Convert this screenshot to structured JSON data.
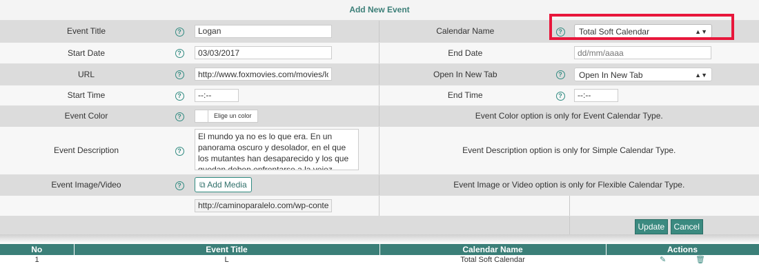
{
  "form": {
    "title": "Add New Event",
    "event_title": {
      "label": "Event Title",
      "value": "Logan"
    },
    "calendar_name": {
      "label": "Calendar Name",
      "value": "Total Soft Calendar"
    },
    "start_date": {
      "label": "Start Date",
      "value": "03/03/2017"
    },
    "end_date": {
      "label": "End Date",
      "placeholder": "dd/mm/aaaa"
    },
    "url": {
      "label": "URL",
      "value": "http://www.foxmovies.com/movies/log"
    },
    "open_in_new_tab": {
      "label": "Open In New Tab",
      "value": "Open In New Tab"
    },
    "start_time": {
      "label": "Start Time",
      "value": "--:--"
    },
    "end_time": {
      "label": "End Time",
      "value": "--:--"
    },
    "event_color": {
      "label": "Event Color",
      "button": "Elige un color",
      "note": "Event Color option is only for Event Calendar Type."
    },
    "event_description": {
      "label": "Event Description",
      "value": "El mundo ya no es lo que era. En un panorama oscuro y desolador, en el que los mutantes han desaparecido y los que quedan deben enfrentarse a la vejez, Logan, también",
      "note": "Event Description option is only for Simple Calendar Type."
    },
    "event_media": {
      "label": "Event Image/Video",
      "button": "Add Media",
      "note": "Event Image or Video option is only for Flexible Calendar Type.",
      "path": "http://caminoparalelo.com/wp-content"
    },
    "update_label": "Update",
    "cancel_label": "Cancel",
    "help_glyph": "?"
  },
  "list": {
    "columns": [
      "No",
      "Event Title",
      "Calendar Name",
      "Actions"
    ],
    "first_row": {
      "no": "1",
      "title": "L",
      "calendar": "Total Soft Calendar"
    }
  },
  "colors": {
    "accent": "#3b8a80",
    "highlight": "#e8173b"
  }
}
